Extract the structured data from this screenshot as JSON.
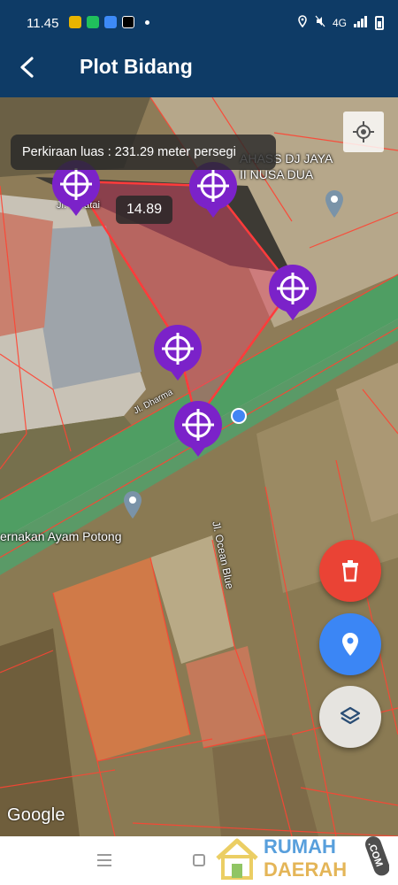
{
  "status_bar": {
    "time": "11.45",
    "network": "4G",
    "app_icons": [
      "#e8b400",
      "#20c05c",
      "#3d8af7",
      "#000000"
    ]
  },
  "app_bar": {
    "title": "Plot Bidang",
    "back_icon": "arrow-back-icon"
  },
  "map": {
    "area_estimate": "Perkiraan luas : 231.29 meter persegi",
    "edge_length": "14.89",
    "places": [
      {
        "name": "AHASS DJ JAYA\nII NUSA DUA"
      },
      {
        "name": "ernakan Ayam Potong"
      }
    ],
    "streets": [
      "Jl. Seratai",
      "Jl. Dharma",
      "Jl. Ocean Blue"
    ],
    "attribution": "Google",
    "pin_count": 5,
    "colors": {
      "plot_fill": "#e84a6a",
      "plot_border": "#ff3b3b",
      "pin": "#7b22c9",
      "road": "#4f9e63"
    }
  },
  "fabs": {
    "delete_icon": "trash-icon",
    "location_icon": "location-pin-icon",
    "layers_icon": "layers-icon",
    "delete_color": "#ea4335",
    "location_color": "#3b86f5"
  },
  "watermark": {
    "line1": "RUMAH",
    "line2": "DAERAH",
    "suffix": ".COM"
  }
}
